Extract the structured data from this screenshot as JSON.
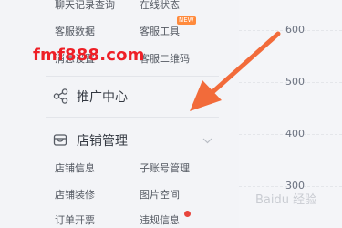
{
  "sidebar": {
    "top_row": {
      "left": "聊天记录查询",
      "right": "在线状态"
    },
    "row2": {
      "left": "客服数据",
      "right": "客服工具",
      "right_badge": "NEW"
    },
    "row3": {
      "left": "消息设置",
      "right": "客服二维码"
    },
    "promotion": {
      "label": "推广中心",
      "icon": "share-icon"
    },
    "store": {
      "label": "店铺管理",
      "icon": "store-icon",
      "items": [
        {
          "left": "店铺信息",
          "right": "子账号管理"
        },
        {
          "left": "店铺装修",
          "right": "图片空间"
        },
        {
          "left": "订单开票",
          "right": "违规信息"
        }
      ]
    }
  },
  "chart": {
    "y_ticks": [
      "600",
      "500",
      "400",
      "300"
    ]
  },
  "watermarks": {
    "site": "fmf888.com",
    "baidu": "Baidu 经验"
  },
  "colors": {
    "annotation_arrow": "#f26b3a",
    "watermark_red": "#ee1f26",
    "alert_dot": "#e8453c"
  }
}
